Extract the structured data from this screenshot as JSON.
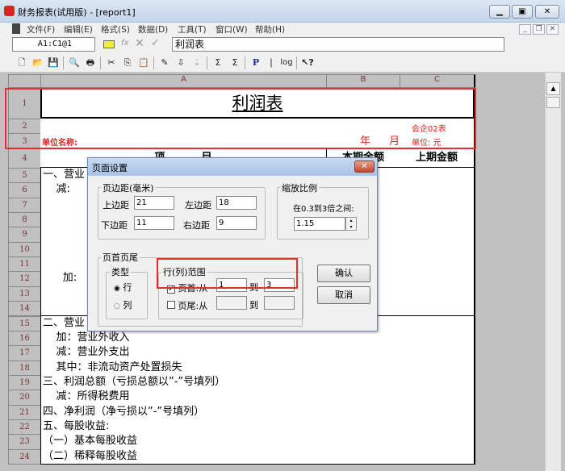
{
  "window": {
    "title": "财务报表(试用版) - [report1]"
  },
  "menu": [
    "文件(F)",
    "编辑(E)",
    "格式(S)",
    "数据(D)",
    "工具(T)",
    "窗口(W)",
    "帮助(H)"
  ],
  "formula": {
    "cell_ref": "A1:C1@1",
    "fx": "fx",
    "content": "利润表"
  },
  "columns": [
    "A",
    "B",
    "C"
  ],
  "sheet": {
    "title": "利润表",
    "form_no": "会企02表",
    "unit_name_label": "单位名称:",
    "year": "年",
    "month": "月",
    "unit_label": "单位: 元",
    "col_item": "项          目",
    "col_current": "本期金额",
    "col_prior": "上期金额",
    "rows": [
      {
        "n": "1"
      },
      {
        "n": "2"
      },
      {
        "n": "3"
      },
      {
        "n": "4"
      },
      {
        "n": "5",
        "text": "一、营业"
      },
      {
        "n": "6",
        "text": "    减:"
      },
      {
        "n": "7",
        "text": ""
      },
      {
        "n": "8",
        "text": ""
      },
      {
        "n": "9",
        "text": ""
      },
      {
        "n": "10",
        "text": ""
      },
      {
        "n": "11",
        "text": ""
      },
      {
        "n": "12",
        "text": "      加:"
      },
      {
        "n": "13",
        "text": ""
      },
      {
        "n": "14",
        "text": ""
      },
      {
        "n": "15",
        "text": "二、营业"
      },
      {
        "n": "16",
        "text": "    加：营业外收入"
      },
      {
        "n": "17",
        "text": "    减：营业外支出"
      },
      {
        "n": "18",
        "text": "    其中：非流动资产处置损失"
      },
      {
        "n": "19",
        "text": "三、利润总额（亏损总额以”-”号填列）"
      },
      {
        "n": "20",
        "text": "    减：所得税费用"
      },
      {
        "n": "21",
        "text": "四、净利润（净亏损以”-”号填列）"
      },
      {
        "n": "22",
        "text": "五、每股收益:"
      },
      {
        "n": "23",
        "text": "（一）基本每股收益"
      },
      {
        "n": "24",
        "text": "（二）稀释每股收益"
      }
    ]
  },
  "dialog": {
    "title": "页面设置",
    "margins_group": "页边距(毫米)",
    "top_label": "上边距",
    "top": "21",
    "left_label": "左边距",
    "left": "18",
    "bottom_label": "下边距",
    "bottom": "11",
    "right_label": "右边距",
    "right": "9",
    "scale_group": "缩放比例",
    "scale_hint": "在0.3到3倍之间:",
    "scale": "1.15",
    "hf_group": "页首页尾",
    "type_group": "类型",
    "type_row": "行",
    "type_col": "列",
    "range_group": "行(列)范围",
    "header_label": "页首:从",
    "header_from": "1",
    "to1": "到",
    "header_to": "3",
    "footer_label": "页尾:从",
    "footer_from": "",
    "to2": "到",
    "footer_to": "",
    "ok": "确认",
    "cancel": "取消"
  }
}
